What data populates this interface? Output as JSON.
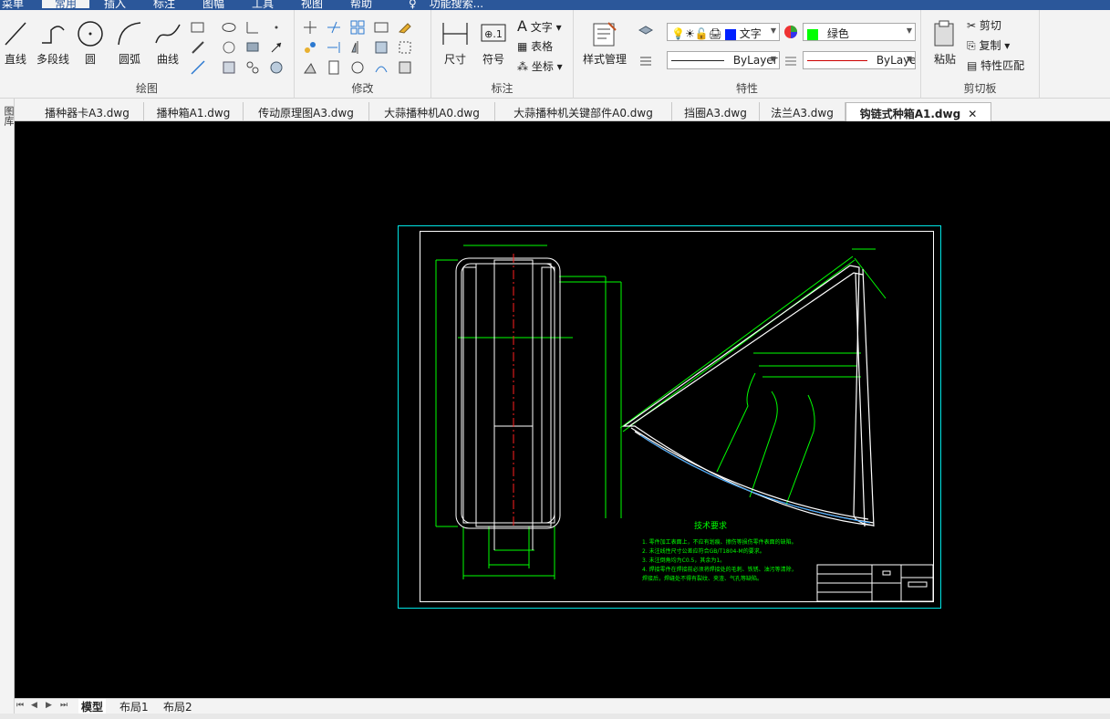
{
  "menu": {
    "items": [
      {
        "label": "菜单"
      },
      {
        "label": "常用"
      },
      {
        "label": "插入"
      },
      {
        "label": "标注"
      },
      {
        "label": "图幅"
      },
      {
        "label": "工具"
      },
      {
        "label": "视图"
      },
      {
        "label": "帮助"
      },
      {
        "label": "功能搜索..."
      }
    ]
  },
  "ribbon": {
    "draw": {
      "label": "绘图",
      "line": "直线",
      "polyline": "多段线",
      "circle": "圆",
      "arc": "圆弧",
      "curve": "曲线"
    },
    "modify": {
      "label": "修改"
    },
    "annotate": {
      "label": "标注",
      "dimension": "尺寸",
      "symbol": "符号",
      "text": "文字",
      "table": "表格",
      "coordinate": "坐标"
    },
    "properties": {
      "label": "特性",
      "style_manager": "样式管理",
      "text_style": "文字",
      "color": "绿色",
      "linetype": "ByLayer",
      "lineweight": "ByLaye"
    },
    "clipboard": {
      "label": "剪切板",
      "paste": "粘贴",
      "cut": "剪切",
      "copy": "复制",
      "match": "特性匹配"
    }
  },
  "tabs": [
    {
      "label": "播种器卡A3.dwg"
    },
    {
      "label": "播种箱A1.dwg"
    },
    {
      "label": "传动原理图A3.dwg"
    },
    {
      "label": "大蒜播种机A0.dwg"
    },
    {
      "label": "大蒜播种机关键部件A0.dwg"
    },
    {
      "label": "挡圈A3.dwg"
    },
    {
      "label": "法兰A3.dwg"
    },
    {
      "label": "钩链式种箱A1.dwg",
      "active": true
    }
  ],
  "sidebar": {
    "label": "图库"
  },
  "drawing": {
    "tech_title": "技术要求",
    "tech_lines": [
      "1. 零件加工表面上，不应有划痕、擦伤等损伤零件表面的缺陷。",
      "2. 未注线性尺寸公差应符合GB/T1804-M的要求。",
      "3. 未注倒角均为C0.5，其余为1。",
      "4. 焊接零件在焊接前必须将焊接处的毛刺、铁锈、油污等清除，",
      "   焊接后，焊缝处不得有裂纹、夹渣、气孔等缺陷。"
    ]
  },
  "layouts": [
    {
      "label": "模型",
      "active": true
    },
    {
      "label": "布局1"
    },
    {
      "label": "布局2"
    }
  ],
  "colors": {
    "accent": "#2b579a",
    "cad_green": "#00ff00",
    "cad_cyan": "#00e5e5",
    "cad_red": "#ff2020"
  }
}
